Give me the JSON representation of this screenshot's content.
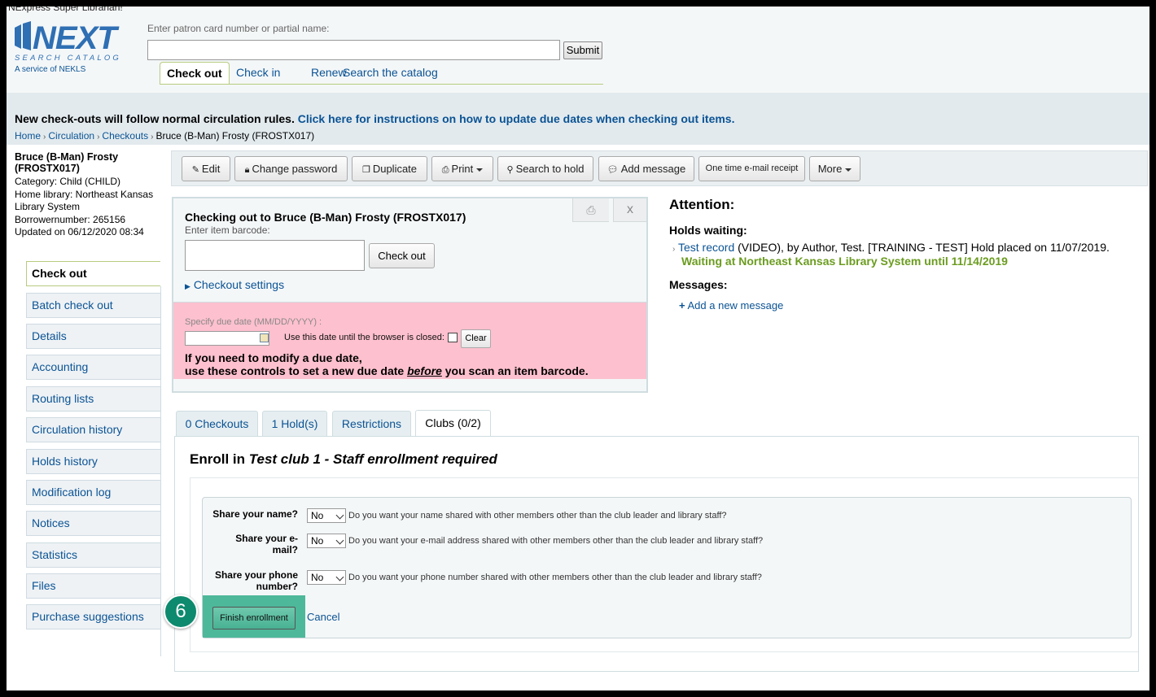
{
  "header": {
    "user_label": "NExpress Super Librarian!",
    "logo_text": "NEXT",
    "logo_subtext": "SEARCH CATALOG",
    "logo_tagline": "A service of NEKLS",
    "search_hint": "Enter patron card number or partial name:",
    "patron_input_value": "",
    "submit_label": "Submit",
    "tabs": [
      "Check out",
      "Check in",
      "Renew",
      "Search the catalog"
    ]
  },
  "notice": {
    "text": "New check-outs will follow normal circulation rules.",
    "link": "Click here for instructions on how to update due dates when checking out items."
  },
  "breadcrumb": [
    "Home",
    "Circulation",
    "Checkouts",
    "Bruce (B-Man) Frosty (FROSTX017)"
  ],
  "patron": {
    "name": "Bruce (B-Man) Frosty (FROSTX017)",
    "category": "Category: Child (CHILD)",
    "home_library": "Home library: Northeast Kansas Library System",
    "borrowernumber": "Borrowernumber: 265156",
    "updated": "Updated on 06/12/2020 08:34"
  },
  "sidenav": [
    "Check out",
    "Batch check out",
    "Details",
    "Accounting",
    "Routing lists",
    "Circulation history",
    "Holds history",
    "Modification log",
    "Notices",
    "Statistics",
    "Files",
    "Purchase suggestions"
  ],
  "toolbar": {
    "edit": "Edit",
    "change_password": "Change password",
    "duplicate": "Duplicate",
    "print": "Print",
    "search_to_hold": "Search to hold",
    "add_message": "Add message",
    "email_receipt": "One time e-mail receipt",
    "more": "More"
  },
  "checkout": {
    "title": "Checking out to Bruce (B-Man) Frosty (FROSTX017)",
    "barcode_hint": "Enter item barcode:",
    "barcode_value": "",
    "button": "Check out",
    "settings": "Checkout settings",
    "close": "x",
    "due_label": "Specify due date (MM/DD/YYYY) :",
    "due_value": "",
    "keep_label": "Use this date until the browser is closed:",
    "clear": "Clear",
    "warn_line1": "If you need to modify a due date,",
    "warn_pre": "use these controls to set a new due date ",
    "warn_em": "before",
    "warn_post": " you scan an item barcode."
  },
  "attention": {
    "title": "Attention:",
    "holds_title": "Holds waiting:",
    "hold_link": "Test record",
    "hold_rest": " (VIDEO), by Author, Test. [TRAINING - TEST] Hold placed on 11/07/2019.",
    "hold_wait": "Waiting at Northeast Kansas Library System until 11/14/2019",
    "messages_title": "Messages:",
    "add_message": "Add a new message"
  },
  "lower_tabs": [
    "0 Checkouts",
    "1 Hold(s)",
    "Restrictions",
    "Clubs (0/2)"
  ],
  "enroll": {
    "title_prefix": "Enroll in ",
    "club_name": "Test club 1 - Staff enrollment required",
    "fields": [
      {
        "label": "Share your name?",
        "value": "No",
        "help": "Do you want your name shared with other members other than the club leader and library staff?"
      },
      {
        "label": "Share your e-mail?",
        "value": "No",
        "help": "Do you want your e-mail address shared with other members other than the club leader and library staff?"
      },
      {
        "label": "Share your phone number?",
        "value": "No",
        "help": "Do you want your phone number shared with other members other than the club leader and library staff?"
      }
    ],
    "finish": "Finish enrollment",
    "cancel": "Cancel"
  },
  "step_badge": "6",
  "colors": {
    "link": "#0b5394",
    "notice_bg": "#e2eaee",
    "duedate_bg": "#fdc0ce",
    "hold_wait": "#6b9c1f",
    "highlight": "#4db89a",
    "badge": "#0e8a6e"
  }
}
